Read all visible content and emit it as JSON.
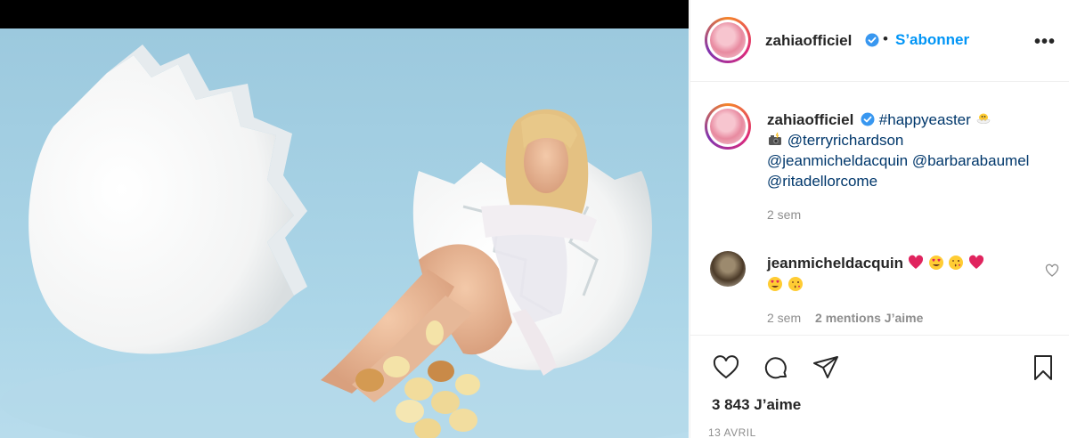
{
  "post": {
    "username": "zahiaofficiel",
    "follow_label": "S’abonner",
    "separator": "•",
    "more_label": "•••"
  },
  "caption": {
    "username": "zahiaofficiel",
    "hashtag": "#happyeaster",
    "mention1": "@terryrichardson",
    "mention2": "@jeanmicheldacquin",
    "mention3": "@barbarabaumel",
    "mention4": "@ritadellorcome",
    "time": "2 sem"
  },
  "comment": {
    "username": "jeanmicheldacquin",
    "time": "2 sem",
    "likes": "2 mentions J’aime"
  },
  "footer": {
    "likes": "3 843 J’aime",
    "date": "13 AVRIL"
  },
  "icons": {
    "verified": "verified-badge-icon",
    "like": "heart-outline-icon",
    "comment": "comment-bubble-icon",
    "share": "paper-plane-icon",
    "save": "bookmark-icon"
  },
  "colors": {
    "accent": "#0095f6",
    "link": "#00376b",
    "muted": "#8e8e8e",
    "photo_bg": "#a9d3e6"
  }
}
